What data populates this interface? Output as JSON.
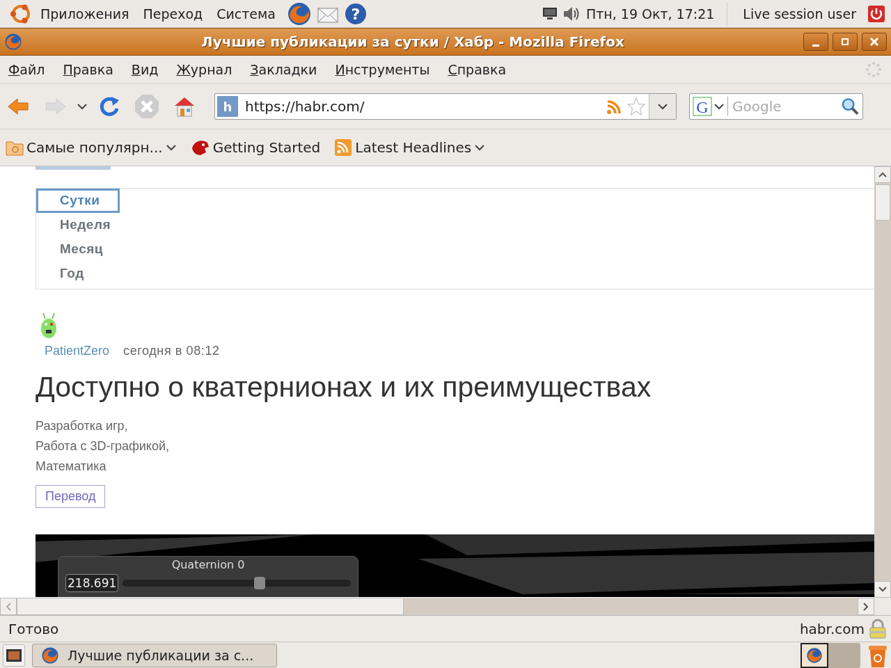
{
  "top_panel": {
    "menus": [
      "Приложения",
      "Переход",
      "Система"
    ],
    "help_glyph": "?",
    "clock": "Птн, 19 Окт, 17:21",
    "user": "Live session user"
  },
  "window": {
    "title": "Лучшие публикации за сутки / Хабр - Mozilla Firefox"
  },
  "menu_bar": [
    "Файл",
    "Правка",
    "Вид",
    "Журнал",
    "Закладки",
    "Инструменты",
    "Справка"
  ],
  "toolbar": {
    "favicon_glyph": "h",
    "url": "https://habr.com/",
    "search": {
      "engine_glyph": "G",
      "placeholder": "Google"
    }
  },
  "bookmarks": [
    {
      "label": "Самые популярн...",
      "kind": "folder"
    },
    {
      "label": "Getting Started",
      "kind": "page"
    },
    {
      "label": "Latest Headlines",
      "kind": "feed"
    }
  ],
  "page": {
    "periods": [
      {
        "label": "Сутки",
        "selected": true
      },
      {
        "label": "Неделя",
        "selected": false
      },
      {
        "label": "Месяц",
        "selected": false
      },
      {
        "label": "Год",
        "selected": false
      }
    ],
    "post": {
      "author": "PatientZero",
      "time": "сегодня в 08:12",
      "title": "Доступно о кватернионах и их преимуществах",
      "hubs": [
        "Разработка игр,",
        "Работа с 3D-графикой,",
        "Математика"
      ],
      "label": "Перевод",
      "figure": {
        "caption": "Quaternion 0",
        "value": "218.691",
        "level": 0.6
      }
    }
  },
  "status_bar": {
    "text": "Готово",
    "host": "habr.com"
  },
  "taskbar": {
    "tasks": [
      {
        "label": "Лучшие публикации за с..."
      }
    ]
  }
}
